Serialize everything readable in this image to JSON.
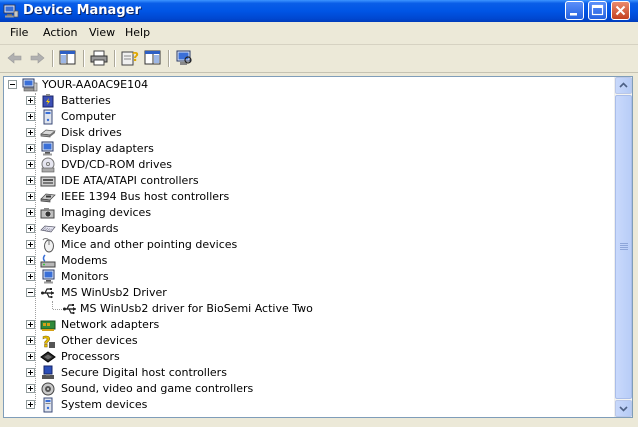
{
  "window": {
    "title": "Device Manager",
    "minimize_label": "_",
    "maximize_label": "□",
    "close_label": "✕"
  },
  "menu": {
    "items": [
      {
        "label": "File"
      },
      {
        "label": "Action"
      },
      {
        "label": "View"
      },
      {
        "label": "Help"
      }
    ]
  },
  "toolbar": {
    "buttons": [
      {
        "icon": "back-arrow-icon"
      },
      {
        "icon": "forward-arrow-icon"
      },
      {
        "icon": "show-hide-console-tree-icon"
      },
      {
        "icon": "print-icon"
      },
      {
        "icon": "help-icon"
      },
      {
        "icon": "export-list-icon"
      },
      {
        "icon": "scan-hardware-icon"
      }
    ]
  },
  "tree": {
    "root": {
      "label": "YOUR-AA0AC9E104",
      "icon": "computer-icon"
    },
    "items": [
      {
        "label": "Batteries",
        "icon": "battery-icon",
        "expanded": false
      },
      {
        "label": "Computer",
        "icon": "computer-icon",
        "expanded": false
      },
      {
        "label": "Disk drives",
        "icon": "disk-drive-icon",
        "expanded": false
      },
      {
        "label": "Display adapters",
        "icon": "display-adapter-icon",
        "expanded": false
      },
      {
        "label": "DVD/CD-ROM drives",
        "icon": "cdrom-icon",
        "expanded": false
      },
      {
        "label": "IDE ATA/ATAPI controllers",
        "icon": "ide-controller-icon",
        "expanded": false
      },
      {
        "label": "IEEE 1394 Bus host controllers",
        "icon": "firewire-icon",
        "expanded": false
      },
      {
        "label": "Imaging devices",
        "icon": "camera-icon",
        "expanded": false
      },
      {
        "label": "Keyboards",
        "icon": "keyboard-icon",
        "expanded": false
      },
      {
        "label": "Mice and other pointing devices",
        "icon": "mouse-icon",
        "expanded": false
      },
      {
        "label": "Modems",
        "icon": "modem-icon",
        "expanded": false
      },
      {
        "label": "Monitors",
        "icon": "monitor-icon",
        "expanded": false
      },
      {
        "label": "MS WinUsb2 Driver",
        "icon": "usb-icon",
        "expanded": true,
        "children": [
          {
            "label": "MS WinUsb2 driver for BioSemi Active Two",
            "icon": "usb-icon"
          }
        ]
      },
      {
        "label": "Network adapters",
        "icon": "network-adapter-icon",
        "expanded": false
      },
      {
        "label": "Other devices",
        "icon": "question-icon",
        "expanded": false
      },
      {
        "label": "Processors",
        "icon": "processor-icon",
        "expanded": false
      },
      {
        "label": "Secure Digital host controllers",
        "icon": "sd-controller-icon",
        "expanded": false
      },
      {
        "label": "Sound, video and game controllers",
        "icon": "sound-icon",
        "expanded": false
      },
      {
        "label": "System devices",
        "icon": "system-device-icon",
        "expanded": false
      }
    ]
  },
  "colors": {
    "titlebar": "#0055e5",
    "window_bg": "#ece9d8",
    "panel_border": "#7f9db9"
  }
}
